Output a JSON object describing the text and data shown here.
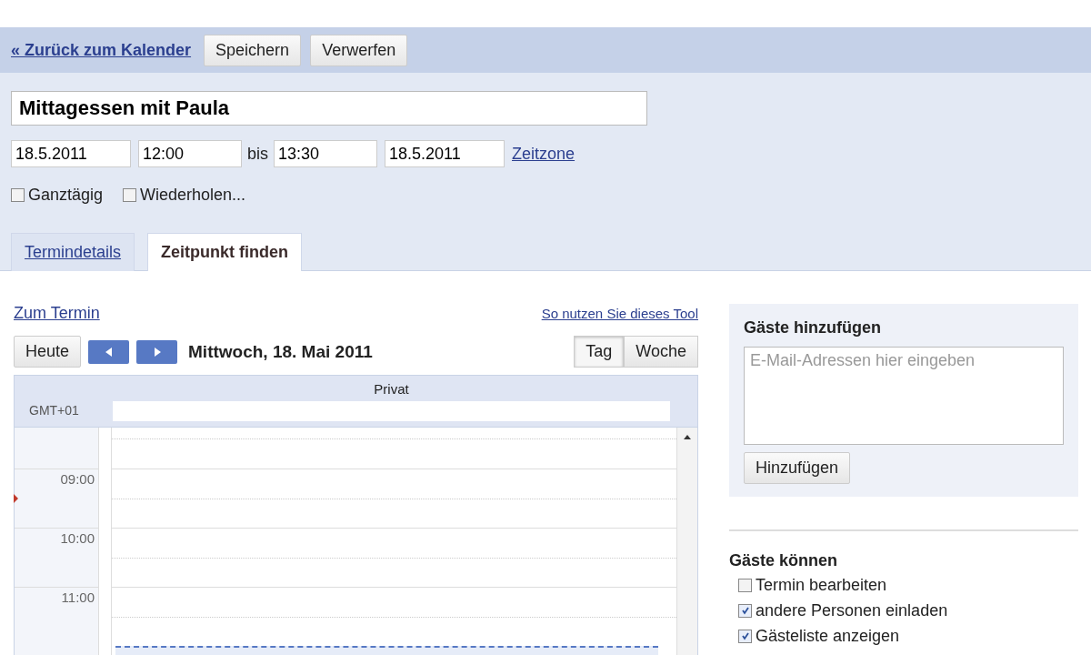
{
  "back_link": "« Zurück zum Kalender",
  "buttons": [
    {
      "label": "Speichern"
    },
    {
      "label": "Verwerfen"
    }
  ],
  "title_field": {
    "value": "Mittagessen mit Paula"
  },
  "time": {
    "start_date": "18.5.2011",
    "start_time": "12:00",
    "separator": "bis",
    "end_time": "13:30",
    "end_date": "18.5.2011",
    "timezone_link": "Zeitzone"
  },
  "options": [
    {
      "label": "Ganztägig",
      "checked": false
    },
    {
      "label": "Wiederholen...",
      "checked": false
    }
  ],
  "tabs": [
    {
      "label": "Termindetails",
      "selected": false
    },
    {
      "label": "Zeitpunkt finden",
      "selected": true
    }
  ],
  "finder": {
    "back_link": "Zum Termin",
    "help_link": "So nutzen Sie dieses Tool",
    "today_button": "Heute",
    "date_label": "Mittwoch, 18. Mai 2011",
    "views": [
      {
        "label": "Tag",
        "selected": true
      },
      {
        "label": "Woche",
        "selected": false
      }
    ],
    "calendar_name": "Privat",
    "timezone": "GMT+01",
    "hours": [
      "09:00",
      "10:00",
      "11:00"
    ]
  },
  "guests": {
    "title": "Gäste hinzufügen",
    "placeholder": "E-Mail-Adressen hier eingeben",
    "add_button": "Hinzufügen",
    "permissions_title": "Gäste können",
    "permissions": [
      {
        "label": "Termin bearbeiten",
        "checked": false
      },
      {
        "label": "andere Personen einladen",
        "checked": true
      },
      {
        "label": "Gästeliste anzeigen",
        "checked": true
      }
    ]
  }
}
